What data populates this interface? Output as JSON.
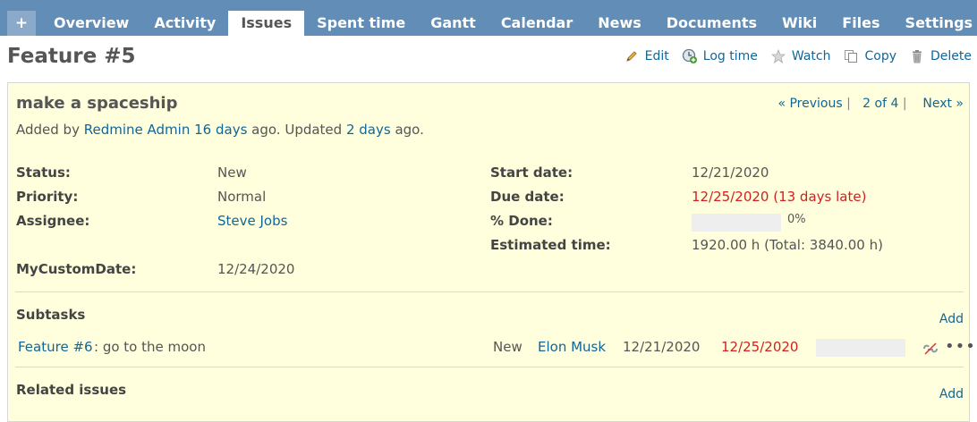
{
  "tabs": [
    "+",
    "Overview",
    "Activity",
    "Issues",
    "Spent time",
    "Gantt",
    "Calendar",
    "News",
    "Documents",
    "Wiki",
    "Files",
    "Settings"
  ],
  "selected_tab": "Issues",
  "issue": {
    "title": "Feature #5",
    "subject": "make a spaceship"
  },
  "actions": {
    "edit": "Edit",
    "log_time": "Log time",
    "watch": "Watch",
    "copy": "Copy",
    "delete": "Delete"
  },
  "nav": {
    "previous": "« Previous",
    "position": "2 of 4",
    "next": "Next »",
    "sep": "|"
  },
  "author": {
    "added_by": "Added by",
    "name": "Redmine Admin",
    "added_ago": "16 days",
    "ago_updated": "ago. Updated",
    "updated_ago": "2 days",
    "ago_end": "ago."
  },
  "attributes": {
    "status_label": "Status:",
    "status": "New",
    "priority_label": "Priority:",
    "priority": "Normal",
    "assignee_label": "Assignee:",
    "assignee": "Steve Jobs",
    "start_label": "Start date:",
    "start": "12/21/2020",
    "due_label": "Due date:",
    "due": "12/25/2020 (13 days late)",
    "done_label": "% Done:",
    "done": "0%",
    "done_value": 0,
    "estimated_label": "Estimated time:",
    "estimated": "1920.00 h (Total: 3840.00 h)",
    "custom_label": "MyCustomDate:",
    "custom": "12/24/2020"
  },
  "subtasks": {
    "title": "Subtasks",
    "add": "Add",
    "rows": [
      {
        "id": "Feature #6",
        "subject": ": go to the moon",
        "status": "New",
        "assignee": "Elon Musk",
        "start": "12/21/2020",
        "due": "12/25/2020",
        "done_value": 0
      }
    ]
  },
  "related": {
    "title": "Related issues",
    "add": "Add"
  },
  "colors": {
    "header": "#628db6",
    "link": "#116699",
    "late": "#cc2222",
    "box": "#ffffdd"
  }
}
